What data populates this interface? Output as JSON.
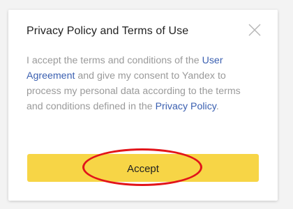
{
  "dialog": {
    "title": "Privacy Policy and Terms of Use",
    "close_icon": "close-icon",
    "text": {
      "part1": "I accept the terms and conditions of the ",
      "link_user_agreement": "User Agreement",
      "part2": " and give my consent to Yandex to process my personal data according to the terms and conditions defined in the ",
      "link_privacy_policy": "Privacy Policy",
      "part3": "."
    },
    "accept_label": "Accept"
  },
  "colors": {
    "accent_button": "#f7d546",
    "link": "#3a5fb0",
    "highlight_ring": "#e2141a"
  }
}
